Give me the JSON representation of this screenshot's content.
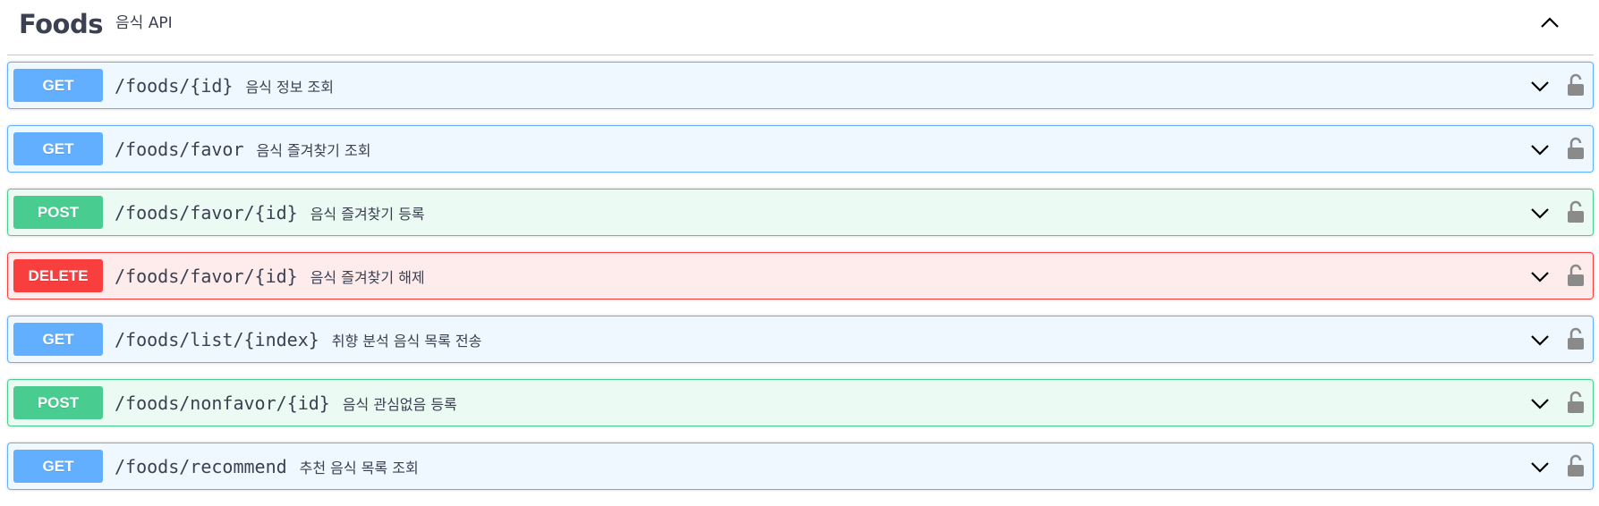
{
  "tag": {
    "name": "Foods",
    "description": "음식 API"
  },
  "operations": [
    {
      "method": "GET",
      "path": "/foods/{id}",
      "summary": "음식 정보 조회"
    },
    {
      "method": "GET",
      "path": "/foods/favor",
      "summary": "음식 즐겨찾기 조회"
    },
    {
      "method": "POST",
      "path": "/foods/favor/{id}",
      "summary": "음식 즐겨찾기 등록"
    },
    {
      "method": "DELETE",
      "path": "/foods/favor/{id}",
      "summary": "음식 즐겨찾기 해제"
    },
    {
      "method": "GET",
      "path": "/foods/list/{index}",
      "summary": "취향 분석 음식 목록 전송"
    },
    {
      "method": "POST",
      "path": "/foods/nonfavor/{id}",
      "summary": "음식 관심없음 등록"
    },
    {
      "method": "GET",
      "path": "/foods/recommend",
      "summary": "추천 음식 목록 조회"
    }
  ],
  "icons": {
    "collapse": "chevron-up-icon",
    "expand": "chevron-down-icon",
    "auth": "lock-icon"
  },
  "colors": {
    "get": "#61affe",
    "post": "#49cc90",
    "delete": "#f93e3e",
    "text": "#3b4151"
  }
}
